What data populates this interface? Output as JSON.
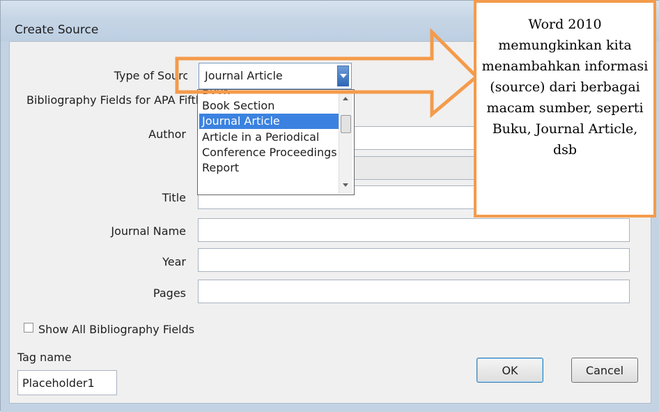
{
  "dialog": {
    "title": "Create Source",
    "type_of_source_label": "Type of Source",
    "type_of_source_value": "Journal Article",
    "bibliography_fields_label": "Bibliography Fields for APA Fifth Edition",
    "dropdown_options": [
      "Book",
      "Book Section",
      "Journal Article",
      "Article in a Periodical",
      "Conference Proceedings",
      "Report"
    ],
    "dropdown_selected": "Journal Article",
    "fields": {
      "author_label": "Author",
      "title_label": "Title",
      "journal_name_label": "Journal Name",
      "year_label": "Year",
      "pages_label": "Pages"
    },
    "show_all_label": "Show All Bibliography Fields",
    "tag_name_label": "Tag name",
    "tag_name_value": "Placeholder1",
    "ok_label": "OK",
    "cancel_label": "Cancel"
  },
  "callout": {
    "text": "Word 2010 memungkinkan kita menambahkan informasi (source) dari berbagai macam sumber, seperti Buku, Journal Article, dsb"
  },
  "colors": {
    "annotation_orange": "#f49b4b",
    "selection_blue": "#3b82e0"
  }
}
